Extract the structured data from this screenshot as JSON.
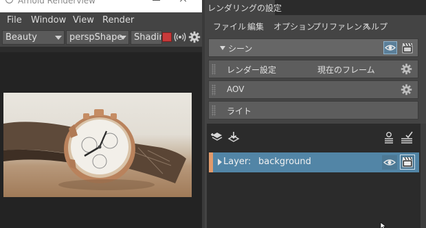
{
  "renderview": {
    "title": "Arnold Renderview",
    "menu": [
      "File",
      "Window",
      "View",
      "Render"
    ],
    "toolbar": {
      "aov": "Beauty",
      "camera": "perspShape",
      "shading": "Shading"
    }
  },
  "render_settings": {
    "tab": "レンダリングの設定",
    "menu": [
      "ファイル",
      "編集",
      "オプション",
      "プリファレンス",
      "ヘルプ"
    ],
    "scene": {
      "label": "シーン"
    },
    "sections": [
      {
        "label": "レンダー設定",
        "value": "現在のフレーム",
        "has_gear": true
      },
      {
        "label": "AOV",
        "value": "",
        "has_gear": true
      },
      {
        "label": "ライト",
        "value": "",
        "has_gear": false
      }
    ],
    "layer": {
      "prefix": "Layer:",
      "name": "background"
    }
  },
  "colors": {
    "accent": "#5285a6",
    "layer_swatch": "#e09a6b",
    "stop": "#c83a3a"
  }
}
